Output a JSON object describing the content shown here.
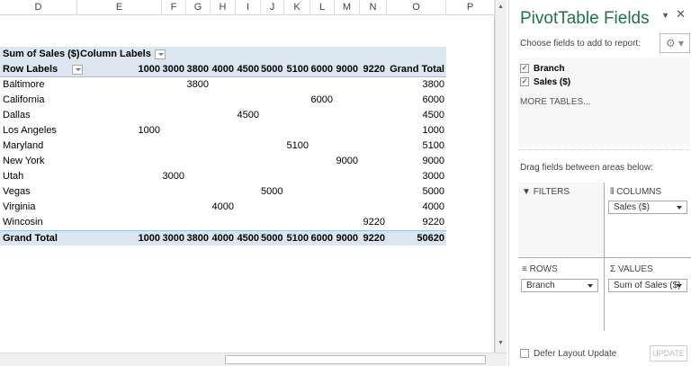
{
  "columns": [
    "D",
    "E",
    "F",
    "G",
    "H",
    "I",
    "J",
    "K",
    "L",
    "M",
    "N",
    "O",
    "P"
  ],
  "pivot": {
    "value_label": "Sum of Sales ($)",
    "column_labels": "Column Labels",
    "row_labels": "Row Labels",
    "col_headers": [
      "1000",
      "3000",
      "3800",
      "4000",
      "4500",
      "5000",
      "5100",
      "6000",
      "9000",
      "9220",
      "Grand Total"
    ],
    "rows": [
      {
        "label": "Baltimore",
        "col": 2,
        "value": "3800",
        "total": "3800"
      },
      {
        "label": "California",
        "col": 7,
        "value": "6000",
        "total": "6000"
      },
      {
        "label": "Dallas",
        "col": 4,
        "value": "4500",
        "total": "4500"
      },
      {
        "label": "Los Angeles",
        "col": 0,
        "value": "1000",
        "total": "1000"
      },
      {
        "label": "Maryland",
        "col": 6,
        "value": "5100",
        "total": "5100"
      },
      {
        "label": "New York",
        "col": 8,
        "value": "9000",
        "total": "9000"
      },
      {
        "label": "Utah",
        "col": 1,
        "value": "3000",
        "total": "3000"
      },
      {
        "label": "Vegas",
        "col": 5,
        "value": "5000",
        "total": "5000"
      },
      {
        "label": "Virginia",
        "col": 3,
        "value": "4000",
        "total": "4000"
      },
      {
        "label": "Wincosin",
        "col": 9,
        "value": "9220",
        "total": "9220"
      }
    ],
    "grand_total_label": "Grand Total",
    "grand_totals": [
      "1000",
      "3000",
      "3800",
      "4000",
      "4500",
      "5000",
      "5100",
      "6000",
      "9000",
      "9220",
      "50620"
    ]
  },
  "panel": {
    "title": "PivotTable Fields",
    "choose": "Choose fields to add to report:",
    "fields": [
      {
        "label": "Branch",
        "checked": true
      },
      {
        "label": "Sales ($)",
        "checked": true
      }
    ],
    "more_tables": "MORE TABLES...",
    "drag": "Drag fields between areas below:",
    "filters": "FILTERS",
    "columns": "COLUMNS",
    "rows": "ROWS",
    "values": "VALUES",
    "columns_field": "Sales ($)",
    "rows_field": "Branch",
    "values_field": "Sum of Sales ($)",
    "defer": "Defer Layout Update",
    "update": "UPDATE"
  },
  "accent": "#217346"
}
